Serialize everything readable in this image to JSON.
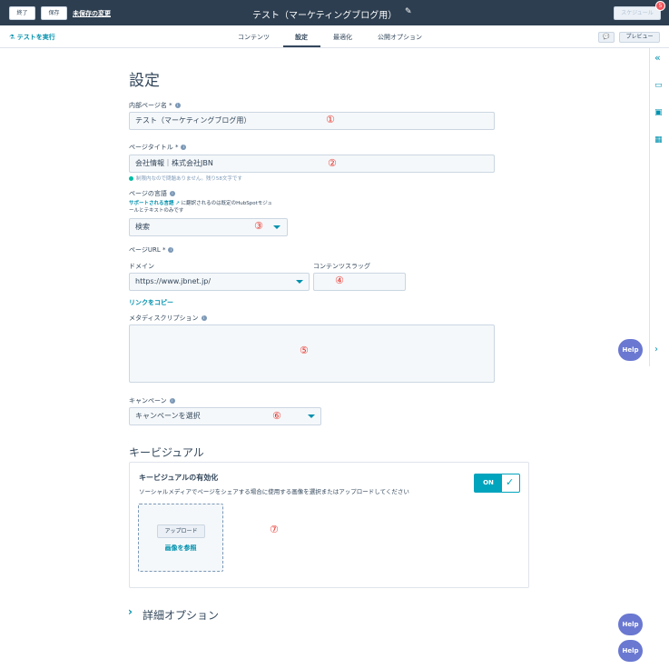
{
  "topbar": {
    "exit_label": "終了",
    "save_label": "保存",
    "unsaved_label": "未保存の変更",
    "title": "テスト（マーケティングブログ用）",
    "schedule_label": "スケジュール",
    "notification_count": "5"
  },
  "tabbar": {
    "run_test_label": "テストを実行",
    "tabs": [
      "コンテンツ",
      "設定",
      "最適化",
      "公開オプション"
    ],
    "active_tab": "設定",
    "preview_label": "プレビュー"
  },
  "settings": {
    "heading": "設定",
    "internal_name": {
      "label": "内部ページ名 *",
      "value": "テスト（マーケティングブログ用）",
      "marker": "①"
    },
    "page_title": {
      "label": "ページタイトル *",
      "value": "会社情報｜株式会社JBN",
      "marker": "②",
      "hint": "制限内なので問題ありません。残り58文字です"
    },
    "language": {
      "label": "ページの言語",
      "supported_link": "サポートされる言語",
      "note_a": "に翻訳されるのは既定のHubSpotモジュ",
      "note_b": "ールとテキストのみです",
      "value": "検索",
      "marker": "③"
    },
    "page_url": {
      "label": "ページURL *",
      "domain_label": "ドメイン",
      "domain_value": "https://www.jbnet.jp/",
      "slug_label": "コンテンツスラッグ",
      "slug_marker": "④",
      "copy_link": "リンクをコピー"
    },
    "meta_description": {
      "label": "メタディスクリプション",
      "marker": "⑤"
    },
    "campaign": {
      "label": "キャンペーン",
      "value": "キャンペーンを選択",
      "marker": "⑥"
    },
    "key_visual": {
      "heading": "キービジュアル",
      "enable_title": "キービジュアルの有効化",
      "description": "ソーシャルメディアでページをシェアする場合に使用する画像を選択またはアップロードしてください",
      "toggle_label": "ON",
      "toggle_on": true,
      "upload_label": "アップロード",
      "browse_label": "画像を参照",
      "marker": "⑦"
    },
    "advanced_options": "詳細オプション"
  },
  "help": {
    "label": "Help"
  },
  "colors": {
    "accent": "#0091ae",
    "topbar": "#2d3e50",
    "marker": "#e8332b",
    "help": "#6a78d1"
  }
}
